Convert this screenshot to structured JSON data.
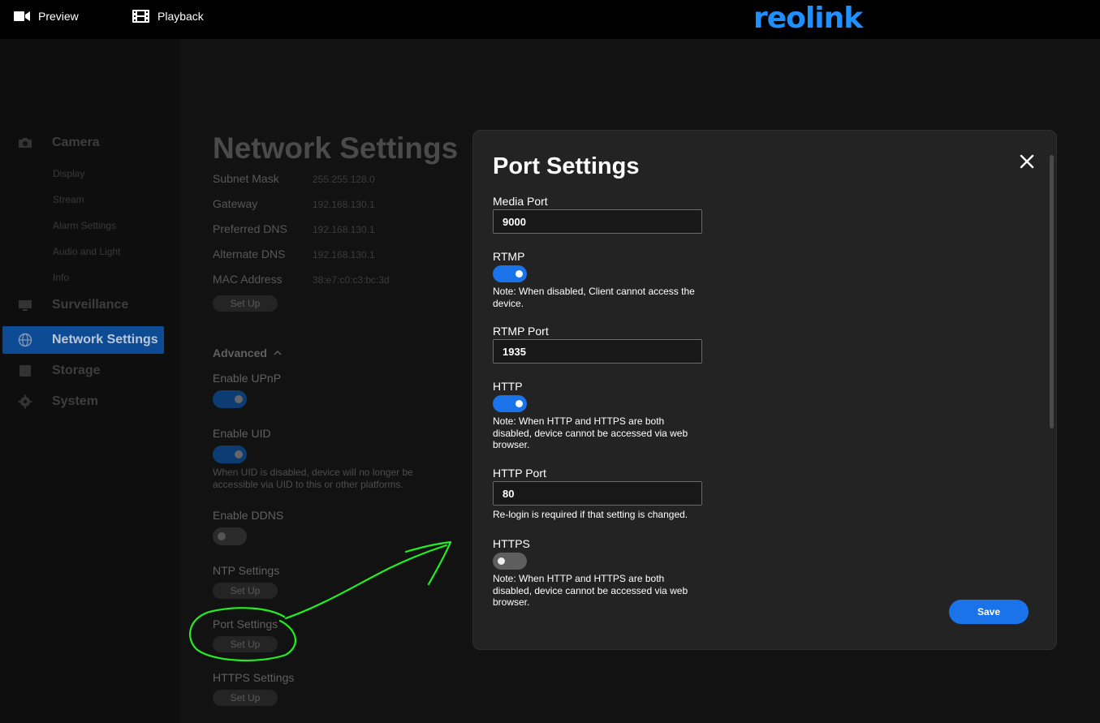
{
  "topbar": {
    "preview_label": "Preview",
    "playback_label": "Playback",
    "logo_text": "reolink"
  },
  "sidebar": {
    "camera": {
      "label": "Camera",
      "items": [
        "Display",
        "Stream",
        "Alarm Settings",
        "Audio and Light",
        "Info"
      ]
    },
    "surveillance": "Surveillance",
    "network": "Network Settings",
    "storage": "Storage",
    "system": "System"
  },
  "page": {
    "title": "Network Settings",
    "info": [
      {
        "label": "Subnet Mask",
        "value": "255.255.128.0"
      },
      {
        "label": "Gateway",
        "value": "192.168.130.1"
      },
      {
        "label": "Preferred DNS",
        "value": "192.168.130.1"
      },
      {
        "label": "Alternate DNS",
        "value": "192.168.130.1"
      },
      {
        "label": "MAC Address",
        "value": "38:e7:c0:c3:bc:3d"
      }
    ],
    "setup_label": "Set Up",
    "advanced_label": "Advanced",
    "upnp_label": "Enable UPnP",
    "uid_label": "Enable UID",
    "uid_note": "When UID is disabled, device will no longer be accessible via UID to this or other platforms.",
    "ddns_label": "Enable DDNS",
    "ntp_label": "NTP Settings",
    "port_label": "Port Settings",
    "https_label": "HTTPS Settings"
  },
  "modal": {
    "title": "Port Settings",
    "media_port_label": "Media Port",
    "media_port_value": "9000",
    "rtmp_label": "RTMP",
    "rtmp_enabled": true,
    "rtmp_note": "Note: When disabled, Client cannot access the device.",
    "rtmp_port_label": "RTMP Port",
    "rtmp_port_value": "1935",
    "http_label": "HTTP",
    "http_enabled": true,
    "http_note": "Note: When HTTP and HTTPS are both disabled, device cannot be accessed via web browser.",
    "http_port_label": "HTTP Port",
    "http_port_value": "80",
    "http_port_note": "Re-login is required if that setting is changed.",
    "https_label": "HTTPS",
    "https_enabled": false,
    "https_note": "Note: When HTTP and HTTPS are both disabled, device cannot be accessed via web browser.",
    "save_label": "Save"
  },
  "colors": {
    "accent": "#1a73e8",
    "logo": "#1e90ff",
    "annotation": "#22ee22"
  }
}
